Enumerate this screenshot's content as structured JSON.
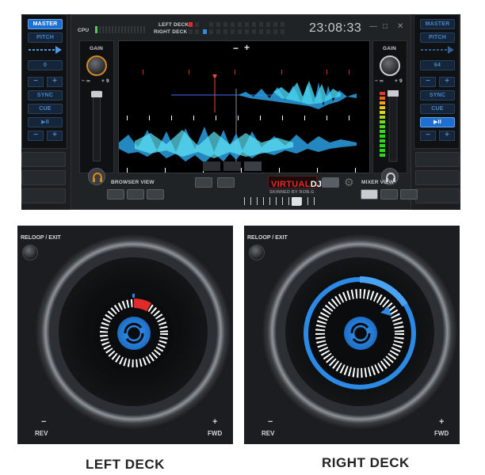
{
  "top": {
    "cpu_label": "CPU",
    "left_deck_label": "LEFT DECK",
    "right_deck_label": "RIGHT DECK",
    "clock": "23:08:33",
    "window_min": "—",
    "window_max": "□",
    "window_close": "✕",
    "zoom_minus": "−",
    "zoom_plus": "+",
    "browser_view": "BROWSER VIEW",
    "mixer_view": "MIXER VIEW",
    "logo_virtual": "VIRTUAL",
    "logo_dj": "DJ",
    "skin_credit": "SKINNED BY ROB.G"
  },
  "left_column": {
    "master": "MASTER",
    "pitch": "PITCH",
    "value": "0",
    "sync": "SYNC",
    "cue": "CUE",
    "play": "▶II",
    "minus": "−",
    "plus": "+"
  },
  "right_column": {
    "master": "MASTER",
    "pitch": "PITCH",
    "value": "64",
    "sync": "SYNC",
    "cue": "CUE",
    "play": "▶II",
    "minus": "−",
    "plus": "+"
  },
  "gain": {
    "left_label": "GAIN",
    "left_min": "− ∞",
    "left_max": "+ 9",
    "right_label": "GAIN",
    "right_min": "− ∞",
    "right_max": "+ 9"
  },
  "decks": {
    "left": {
      "reloop": "RELOOP / EXIT",
      "rev": "REV",
      "fwd": "FWD",
      "minus": "−",
      "plus": "+",
      "title": "LEFT DECK"
    },
    "right": {
      "reloop": "RELOOP / EXIT",
      "rev": "REV",
      "fwd": "FWD",
      "minus": "−",
      "plus": "+",
      "title": "RIGHT DECK"
    }
  },
  "colors": {
    "accent_blue": "#2b8ae6",
    "red_marker": "#e12a2a",
    "orange_knob": "#d78a1a",
    "cyan_wave": "#35c8e8"
  }
}
